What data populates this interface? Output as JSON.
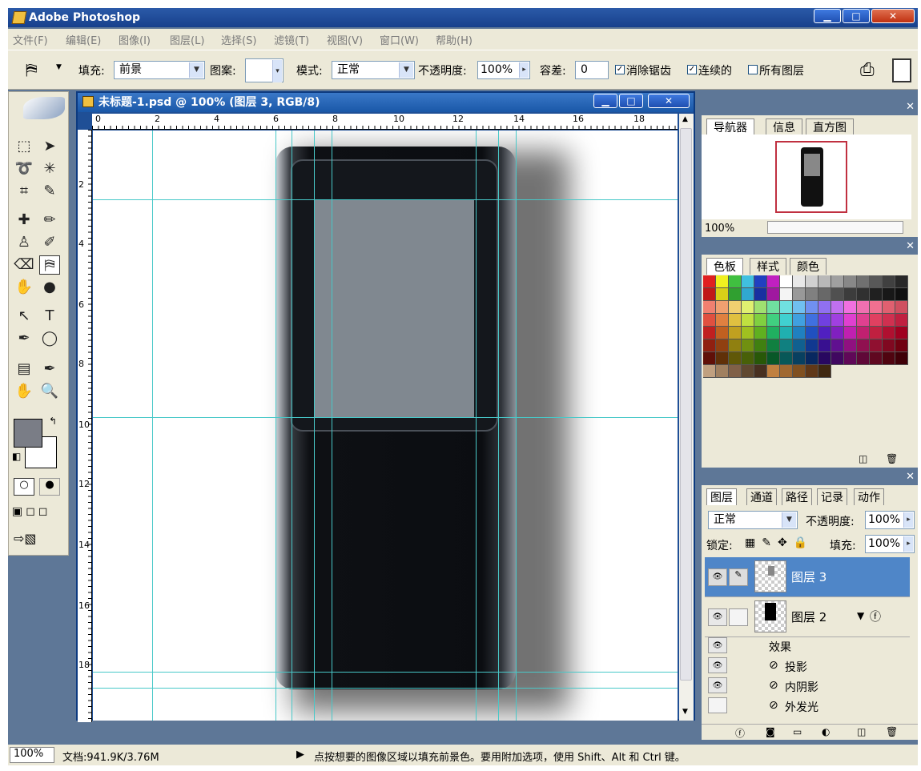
{
  "window": {
    "title": "Adobe Photoshop"
  },
  "menu": [
    "文件(F)",
    "编辑(E)",
    "图像(I)",
    "图层(L)",
    "选择(S)",
    "滤镜(T)",
    "视图(V)",
    "窗口(W)",
    "帮助(H)"
  ],
  "options": {
    "fill_label": "填充:",
    "fill_value": "前景",
    "pattern_label": "图案:",
    "mode_label": "模式:",
    "mode_value": "正常",
    "opacity_label": "不透明度:",
    "opacity_value": "100%",
    "tolerance_label": "容差:",
    "tolerance_value": "0",
    "antialias_label": "消除锯齿",
    "contiguous_label": "连续的",
    "all_layers_label": "所有图层"
  },
  "document": {
    "title": "未标题-1.psd @ 100% (图层 3, RGB/8)",
    "ruler_h": [
      "0",
      "2",
      "4",
      "6",
      "8",
      "10",
      "12",
      "14",
      "16",
      "18"
    ],
    "ruler_v": [
      "2",
      "4",
      "6",
      "8",
      "10",
      "12",
      "14",
      "16",
      "18"
    ]
  },
  "navigator": {
    "tabs": [
      "导航器",
      "信息",
      "直方图"
    ],
    "zoom": "100%"
  },
  "swatches": {
    "tabs": [
      "色板",
      "样式",
      "颜色"
    ]
  },
  "layers": {
    "tabs": [
      "图层",
      "通道",
      "路径",
      "记录",
      "动作"
    ],
    "blend": "正常",
    "opacity_label": "不透明度:",
    "opacity": "100%",
    "lock_label": "锁定:",
    "fill_label": "填充:",
    "fill": "100%",
    "items": [
      {
        "name": "图层 3"
      },
      {
        "name": "图层 2"
      }
    ],
    "effects_label": "效果",
    "effects": [
      "投影",
      "内阴影",
      "外发光"
    ]
  },
  "status": {
    "zoom": "100%",
    "doc": "文档:941.9K/3.76M",
    "hint": "点按想要的图像区域以填充前景色。要用附加选项，使用 Shift、Alt 和 Ctrl 键。"
  },
  "colors": {
    "titlebar": "#17408c",
    "workspace": "#5e7797",
    "panel_bg": "#ece9d8",
    "guide": "#48c8c8",
    "foreground": "#7a7d86",
    "phone_screen": "#808890"
  }
}
